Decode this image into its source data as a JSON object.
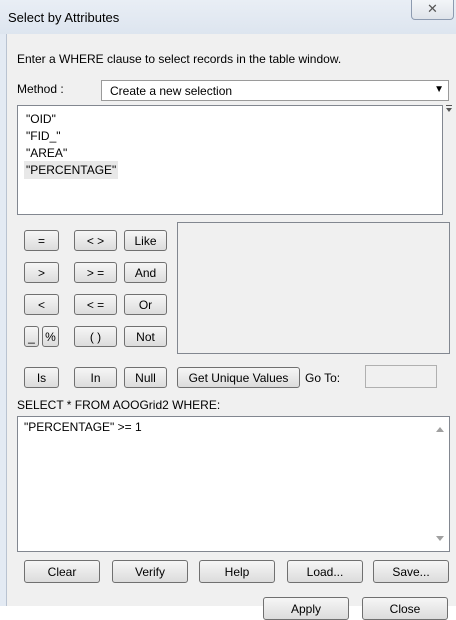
{
  "window": {
    "title": "Select by Attributes",
    "close_glyph": "✕"
  },
  "instructions": "Enter a WHERE clause to select records in the table window.",
  "method": {
    "label": "Method :",
    "value": "Create a new selection"
  },
  "fields": [
    "\"OID\"",
    "\"FID_\"",
    "\"AREA\"",
    "\"PERCENTAGE\""
  ],
  "operators": {
    "eq": "=",
    "ne": "< >",
    "like": "Like",
    "gt": ">",
    "ge": "> =",
    "and": "And",
    "lt": "<",
    "le": "< =",
    "or": "Or",
    "underscore": "_",
    "percent": "%",
    "parens": "( )",
    "not": "Not",
    "is": "Is",
    "in": "In",
    "null": "Null"
  },
  "get_unique_values_label": "Get Unique Values",
  "goto_label": "Go To:",
  "goto_value": "",
  "sql_prefix": "SELECT * FROM AOOGrid2 WHERE:",
  "sql_expression": "\"PERCENTAGE\" >= 1",
  "actions": {
    "clear": "Clear",
    "verify": "Verify",
    "help": "Help",
    "load": "Load...",
    "save": "Save..."
  },
  "footer": {
    "apply": "Apply",
    "close": "Close"
  }
}
